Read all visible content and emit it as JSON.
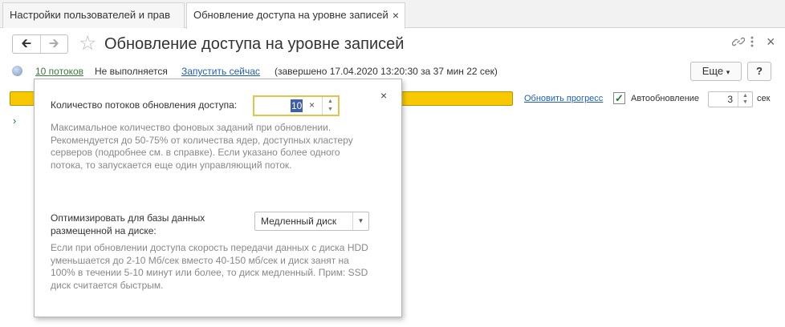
{
  "tabs": [
    {
      "label": "Настройки пользователей и прав"
    },
    {
      "label": "Обновление доступа на уровне записей",
      "close": "×"
    }
  ],
  "header": {
    "title": "Обновление доступа на уровне записей",
    "back_icon": "arrow-left-icon",
    "forward_icon": "arrow-right-icon"
  },
  "status": {
    "threads_link": "10 потоков",
    "state": "Не выполняется",
    "run_now": "Запустить сейчас",
    "finished": "(завершено 17.04.2020 13:20:30 за 37 мин 22 сек)"
  },
  "toolbar": {
    "more_label": "Еще",
    "more_arrow": "▾",
    "help_label": "?"
  },
  "progress": {
    "fraction": 1.0,
    "color": "#f8c800",
    "update_label": "Обновить прогресс",
    "auto_update_label": "Автообновление",
    "auto_update_checked": true,
    "interval_value": "3",
    "interval_unit": "сек"
  },
  "popup": {
    "threads_label": "Количество потоков обновления доступа:",
    "threads_value": "10",
    "threads_clear": "×",
    "threads_hint": "Максимальное количество фоновых заданий при обновлении. Рекомендуется до 50-75% от количества ядер, доступных кластеру серверов (подробнее см. в справке). Если указано более одного потока, то запускается еще один управляющий поток.",
    "optimize_label": "Оптимизировать для базы данных размещенной на диске:",
    "disk_value": "Медленный диск",
    "disk_hint": "Если при обновлении доступа скорость передачи данных с диска HDD уменьшается до 2-10 Мб/сек вместо 40-150 мб/сек и диск занят на 100% в течении 5-10 минут или более, то диск медленный. Прим: SSD диск считается быстрым."
  },
  "colors": {
    "accent_green": "#1b7c2c",
    "link_blue": "#1f5eb7",
    "progress_yellow": "#f8c800",
    "focus_border": "#e3c34c"
  }
}
